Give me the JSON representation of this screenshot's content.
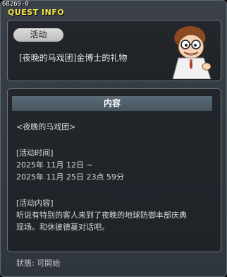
{
  "window": {
    "quest_id": "68269-0",
    "title": "QUEST INFO"
  },
  "quest": {
    "category_tag": "活动",
    "name": "[夜晚的马戏团]金博士的礼物"
  },
  "content": {
    "section_title": "内容",
    "lines": [
      "<夜晚的马戏团>",
      "[活动时间]",
      "2025年 11月 12日 ~",
      "2025年 11月 25日 23点 59分",
      "[活动内容]",
      "听说有特别的客人来到了夜晚的地球防御本部庆典",
      "现场。和休彼德蔓对话吧。"
    ]
  },
  "footer": {
    "status": "狀態: 可開始"
  }
}
